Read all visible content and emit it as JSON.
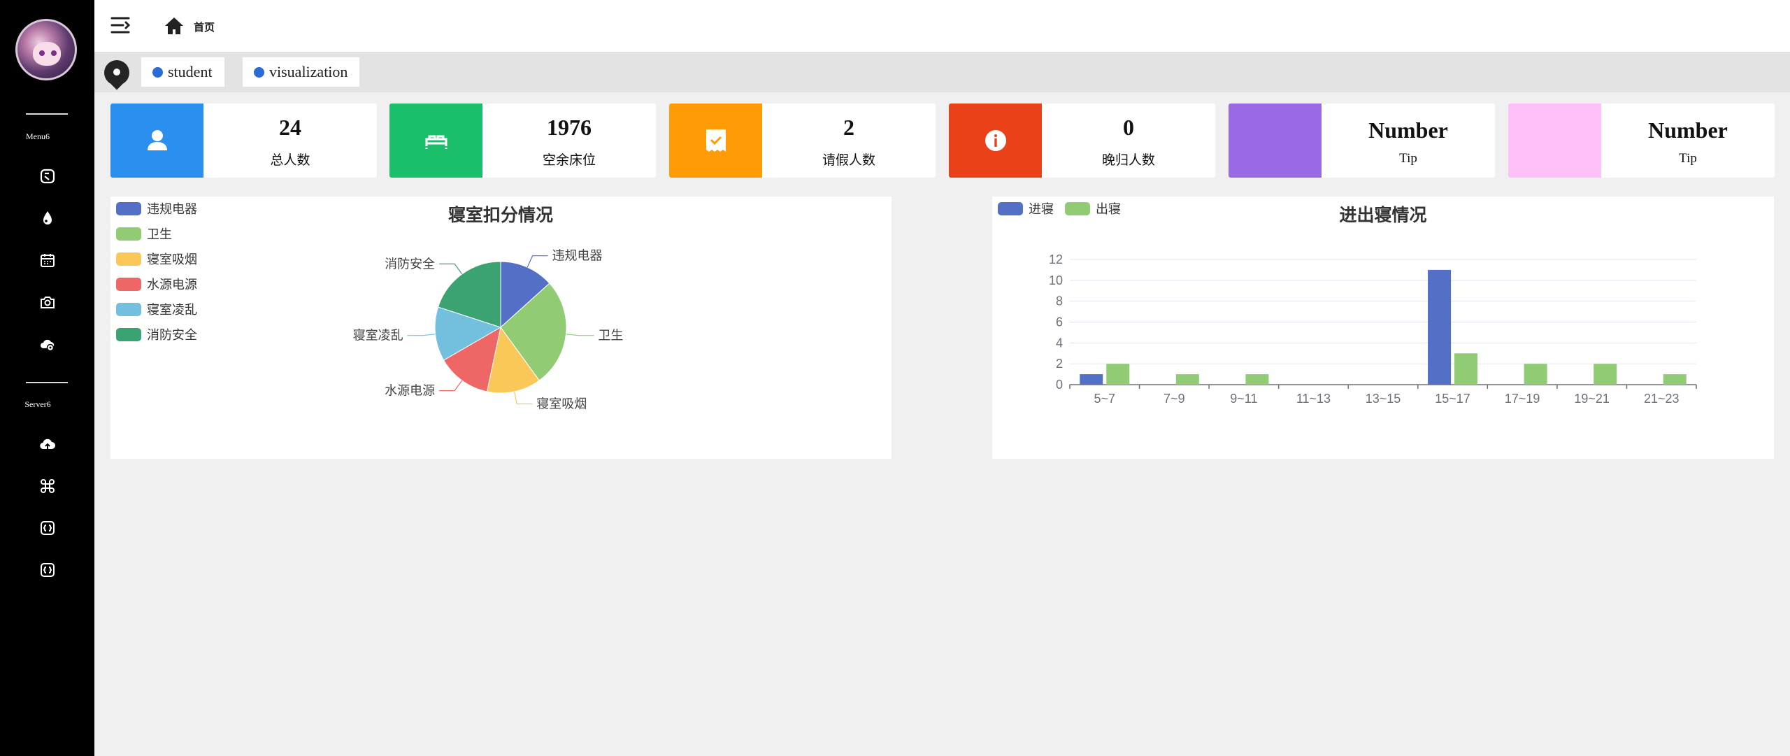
{
  "sidebar": {
    "menu_title": "Menu6",
    "server_title": "Server6",
    "menu_icons": [
      "layout-icon",
      "drop-icon",
      "calendar-icon",
      "camera-icon",
      "cloud-settings-icon"
    ],
    "server_icons": [
      "cloud-upload-icon",
      "command-icon",
      "code-icon",
      "code-icon"
    ]
  },
  "header": {
    "home_label": "首页"
  },
  "tabs": [
    {
      "label": "student"
    },
    {
      "label": "visualization"
    }
  ],
  "cards": [
    {
      "value": "24",
      "label": "总人数",
      "color": "#2b8ff0",
      "icon": "user-icon"
    },
    {
      "value": "1976",
      "label": "空余床位",
      "color": "#1bbf6b",
      "icon": "bed-icon"
    },
    {
      "value": "2",
      "label": "请假人数",
      "color": "#ff9b06",
      "icon": "receipt-check-icon"
    },
    {
      "value": "0",
      "label": "晚归人数",
      "color": "#ea4119",
      "icon": "info-icon"
    },
    {
      "value": "Number",
      "label": "Tip",
      "color": "#9a6ae6"
    },
    {
      "value": "Number",
      "label": "Tip",
      "color": "#ffc0f9"
    }
  ],
  "chart_data": [
    {
      "type": "pie",
      "title": "寝室扣分情况",
      "legend_position": "top-left",
      "categories": [
        "违规电器",
        "卫生",
        "寝室吸烟",
        "水源电源",
        "寝室凌乱",
        "消防安全"
      ],
      "values": [
        1,
        2,
        1,
        1,
        1,
        1.5
      ],
      "colors": [
        "#5470c6",
        "#91cc75",
        "#fac858",
        "#ee6666",
        "#73c0de",
        "#3ba272"
      ]
    },
    {
      "type": "bar",
      "title": "进出寝情况",
      "legend_position": "top-left",
      "categories": [
        "5~7",
        "7~9",
        "9~11",
        "11~13",
        "13~15",
        "15~17",
        "17~19",
        "19~21",
        "21~23"
      ],
      "series": [
        {
          "name": "进寝",
          "values": [
            1,
            0,
            0,
            0,
            0,
            11,
            0,
            0,
            0
          ],
          "color": "#5470c6"
        },
        {
          "name": "出寝",
          "values": [
            2,
            1,
            1,
            0,
            0,
            3,
            2,
            2,
            1
          ],
          "color": "#91cc75"
        }
      ],
      "ylim": [
        0,
        12
      ],
      "yticks": [
        0,
        2,
        4,
        6,
        8,
        10,
        12
      ],
      "grid": true
    }
  ]
}
